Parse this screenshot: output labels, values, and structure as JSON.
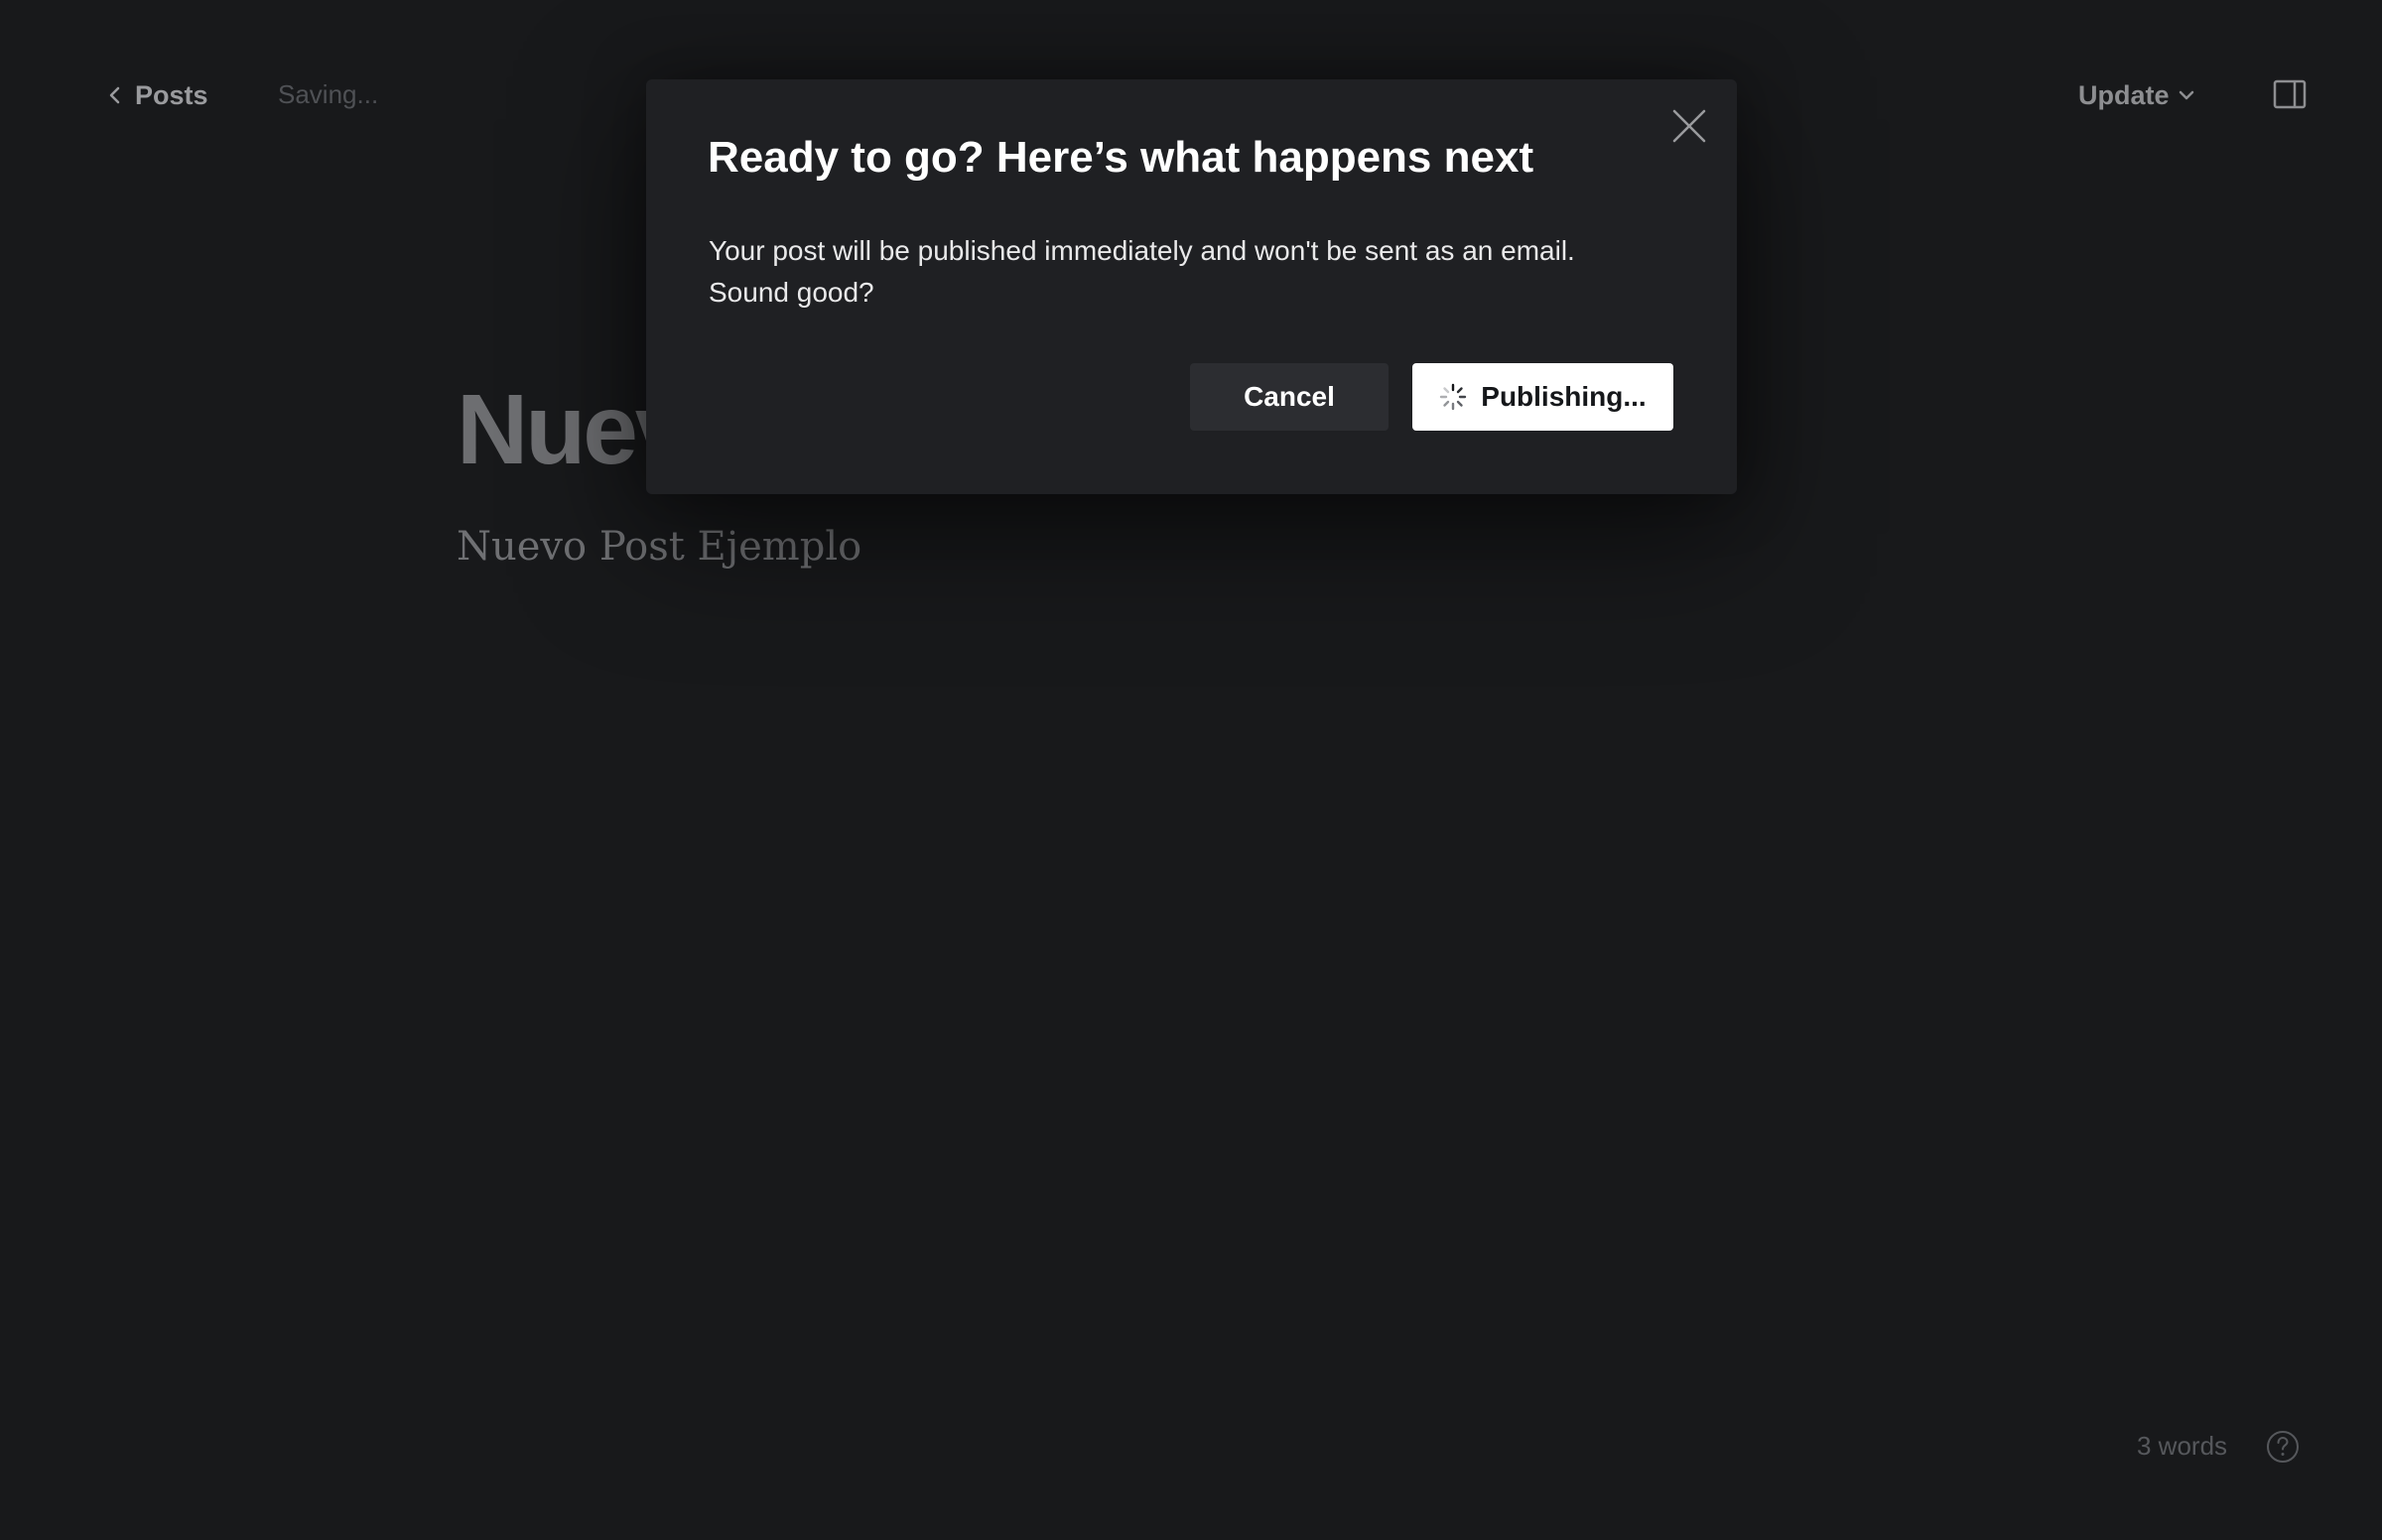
{
  "topbar": {
    "back_label": "Posts",
    "status": "Saving...",
    "update_label": "Update"
  },
  "editor": {
    "title": "Nuevo Post Ejemplo",
    "body": "Nuevo Post Ejemplo"
  },
  "footer": {
    "word_count": "3 words"
  },
  "modal": {
    "title": "Ready to go? Here’s what happens next",
    "message": "Your post will be published immediately and won't be sent as an email. Sound good?",
    "cancel_label": "Cancel",
    "publish_label": "Publishing..."
  },
  "icons": {
    "back": "chevron-left-icon",
    "update_dropdown": "chevron-down-icon",
    "sidebar": "sidebar-toggle-icon",
    "close": "close-icon",
    "spinner": "spinner-icon",
    "help": "help-icon"
  },
  "colors": {
    "background": "#18191b",
    "modal_background": "#1f2023",
    "primary_button": "#ffffff",
    "secondary_button": "#2c2d31"
  }
}
